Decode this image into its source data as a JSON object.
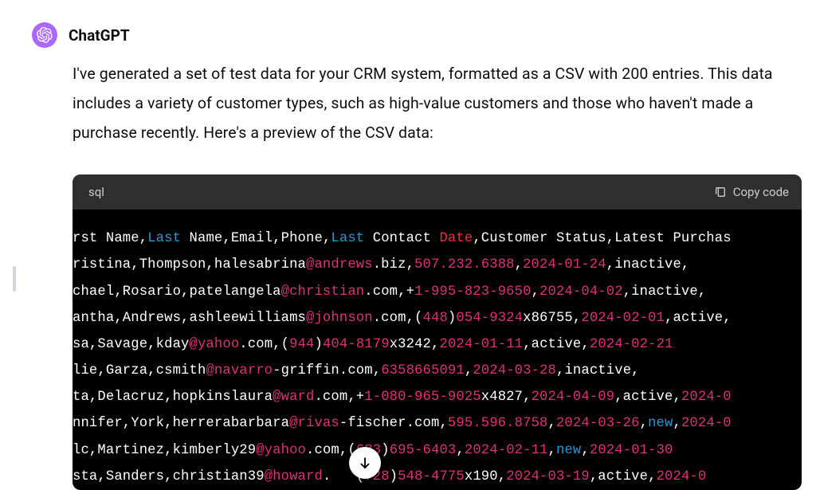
{
  "sender": "ChatGPT",
  "message_text": "I've generated a set of test data for your CRM system, formatted as a CSV with 200 entries. This data includes a variety of customer types, such as high-value customers and those who haven't made a purchase recently. Here's a preview of the CSV data:",
  "code": {
    "language": "sql",
    "copy_label": "Copy code",
    "rows": [
      [
        {
          "t": "rst Name,",
          "c": "wh"
        },
        {
          "t": "Last",
          "c": "blue"
        },
        {
          "t": " Name,Email,Phone,",
          "c": "wh"
        },
        {
          "t": "Last",
          "c": "blue"
        },
        {
          "t": " Contact ",
          "c": "wh"
        },
        {
          "t": "Date",
          "c": "red"
        },
        {
          "t": ",Customer Status,Latest Purchas",
          "c": "wh"
        }
      ],
      [
        {
          "t": "ristina,Thompson,halesabrina",
          "c": "wh"
        },
        {
          "t": "@andrews",
          "c": "pink"
        },
        {
          "t": ".biz,",
          "c": "wh"
        },
        {
          "t": "507.232.6388",
          "c": "pink"
        },
        {
          "t": ",",
          "c": "wh"
        },
        {
          "t": "2024-01-24",
          "c": "pink"
        },
        {
          "t": ",inactive,",
          "c": "wh"
        }
      ],
      [
        {
          "t": "chael,Rosario,patelangela",
          "c": "wh"
        },
        {
          "t": "@christian",
          "c": "pink"
        },
        {
          "t": ".com,",
          "c": "wh"
        },
        {
          "t": "+",
          "c": "wh"
        },
        {
          "t": "1-995-823-9650",
          "c": "pink"
        },
        {
          "t": ",",
          "c": "wh"
        },
        {
          "t": "2024-04-02",
          "c": "pink"
        },
        {
          "t": ",inactive,",
          "c": "wh"
        }
      ],
      [
        {
          "t": "antha,Andrews,ashleewilliams",
          "c": "wh"
        },
        {
          "t": "@johnson",
          "c": "pink"
        },
        {
          "t": ".com,(",
          "c": "wh"
        },
        {
          "t": "448",
          "c": "pink"
        },
        {
          "t": ")",
          "c": "wh"
        },
        {
          "t": "054-9324",
          "c": "pink"
        },
        {
          "t": "x86755,",
          "c": "wh"
        },
        {
          "t": "2024-02-01",
          "c": "pink"
        },
        {
          "t": ",active,",
          "c": "wh"
        }
      ],
      [
        {
          "t": "sa,Savage,kday",
          "c": "wh"
        },
        {
          "t": "@yahoo",
          "c": "pink"
        },
        {
          "t": ".com,(",
          "c": "wh"
        },
        {
          "t": "944",
          "c": "pink"
        },
        {
          "t": ")",
          "c": "wh"
        },
        {
          "t": "404-8179",
          "c": "pink"
        },
        {
          "t": "x3242,",
          "c": "wh"
        },
        {
          "t": "2024-01-11",
          "c": "pink"
        },
        {
          "t": ",active,",
          "c": "wh"
        },
        {
          "t": "2024-02-21",
          "c": "pink"
        }
      ],
      [
        {
          "t": "lie,Garza,csmith",
          "c": "wh"
        },
        {
          "t": "@navarro",
          "c": "pink"
        },
        {
          "t": "-griffin.com,",
          "c": "wh"
        },
        {
          "t": "6358665091",
          "c": "pink"
        },
        {
          "t": ",",
          "c": "wh"
        },
        {
          "t": "2024-03-28",
          "c": "pink"
        },
        {
          "t": ",inactive,",
          "c": "wh"
        }
      ],
      [
        {
          "t": "ta,Delacruz,hopkinslaura",
          "c": "wh"
        },
        {
          "t": "@ward",
          "c": "pink"
        },
        {
          "t": ".com,",
          "c": "wh"
        },
        {
          "t": "+",
          "c": "wh"
        },
        {
          "t": "1-080-965-9025",
          "c": "pink"
        },
        {
          "t": "x4827,",
          "c": "wh"
        },
        {
          "t": "2024-04-09",
          "c": "pink"
        },
        {
          "t": ",active,",
          "c": "wh"
        },
        {
          "t": "2024-0",
          "c": "pink"
        }
      ],
      [
        {
          "t": "nnifer,York,herrerabarbara",
          "c": "wh"
        },
        {
          "t": "@rivas",
          "c": "pink"
        },
        {
          "t": "-fischer.com,",
          "c": "wh"
        },
        {
          "t": "595.596.8758",
          "c": "pink"
        },
        {
          "t": ",",
          "c": "wh"
        },
        {
          "t": "2024-03-26",
          "c": "pink"
        },
        {
          "t": ",",
          "c": "wh"
        },
        {
          "t": "new",
          "c": "blue"
        },
        {
          "t": ",",
          "c": "wh"
        },
        {
          "t": "2024-0",
          "c": "pink"
        }
      ],
      [
        {
          "t": "lc,Martinez,kimberly29",
          "c": "wh"
        },
        {
          "t": "@yahoo",
          "c": "pink"
        },
        {
          "t": ".com,(",
          "c": "wh"
        },
        {
          "t": "683",
          "c": "pink"
        },
        {
          "t": ")",
          "c": "wh"
        },
        {
          "t": "695-6403",
          "c": "pink"
        },
        {
          "t": ",",
          "c": "wh"
        },
        {
          "t": "2024-02-11",
          "c": "pink"
        },
        {
          "t": ",",
          "c": "wh"
        },
        {
          "t": "new",
          "c": "blue"
        },
        {
          "t": ",",
          "c": "wh"
        },
        {
          "t": "2024-01-30",
          "c": "pink"
        }
      ],
      [
        {
          "t": "sta,Sanders,christian39",
          "c": "wh"
        },
        {
          "t": "@howard",
          "c": "pink"
        },
        {
          "t": ".   (",
          "c": "wh"
        },
        {
          "t": "728",
          "c": "pink"
        },
        {
          "t": ")",
          "c": "wh"
        },
        {
          "t": "548-4775",
          "c": "pink"
        },
        {
          "t": "x190,",
          "c": "wh"
        },
        {
          "t": "2024-03-19",
          "c": "pink"
        },
        {
          "t": ",active,",
          "c": "wh"
        },
        {
          "t": "2024-0",
          "c": "pink"
        }
      ]
    ]
  }
}
